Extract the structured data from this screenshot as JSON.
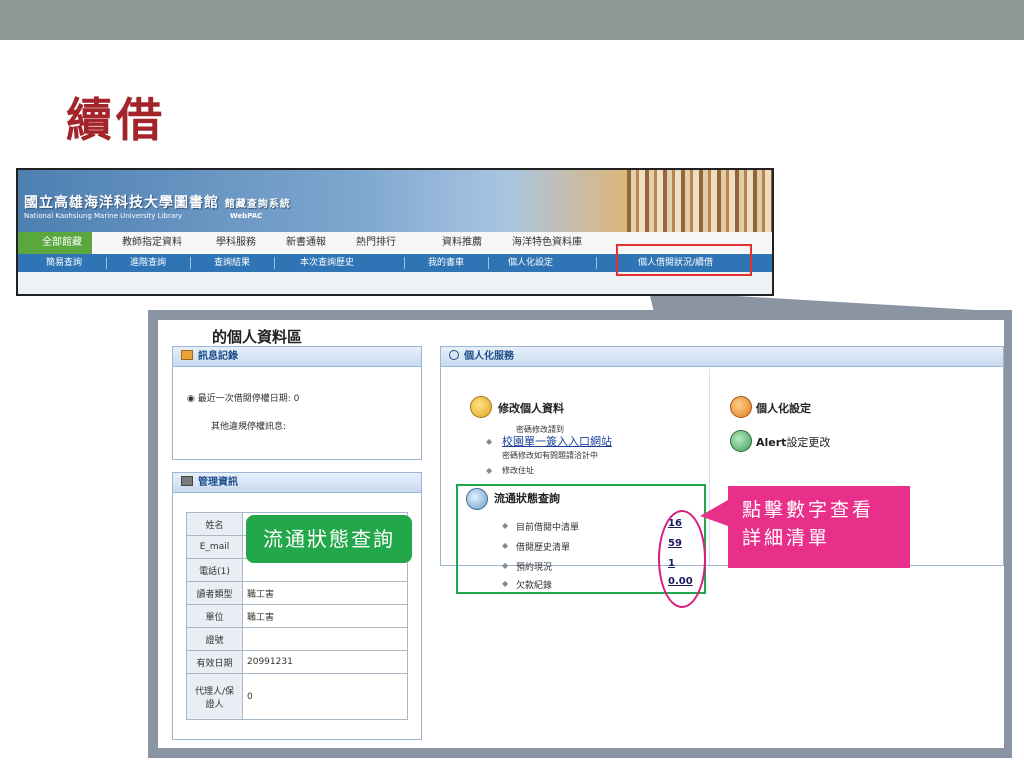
{
  "slide": {
    "title": "續借"
  },
  "library": {
    "name_zh": "國立高雄海洋科技大學圖書館",
    "system_zh": "館藏查詢系統",
    "name_en": "National Kaohsiung Marine University Library",
    "webpac": "WebPAC",
    "top_tabs": [
      "全部館藏",
      "教師指定資料",
      "學科服務",
      "新書通報",
      "熱門排行",
      "資料推薦",
      "海洋特色資料庫"
    ],
    "sub_nav": [
      "簡易查詢",
      "進階查詢",
      "查詢結果",
      "本次查詢歷史",
      "我的書車",
      "個人化設定",
      "個人借閱狀況/續借"
    ]
  },
  "panel": {
    "title": "的個人資料區",
    "messages": {
      "header": "訊息記錄",
      "last_suspend": "最近一次借閱停權日期: 0",
      "other": "其他違規停權訊息:"
    },
    "admin": {
      "header": "管理資訊",
      "rows": [
        {
          "label": "姓名",
          "value": ""
        },
        {
          "label": "E_mail",
          "value": ""
        },
        {
          "label": "電話(1)",
          "value": ""
        },
        {
          "label": "讀者類型",
          "value": "職工害"
        },
        {
          "label": "單位",
          "value": "職工害"
        },
        {
          "label": "證號",
          "value": ""
        },
        {
          "label": "有效日期",
          "value": "20991231"
        },
        {
          "label": "代理人/保證人",
          "value": "0"
        }
      ]
    },
    "services": {
      "header": "個人化服務",
      "modify_title": "修改個人資料",
      "pw_note1": "密碼修改請到",
      "portal_link": "校園單一簽入入口網站",
      "pw_note2": "密碼修改如有問題請洽計中",
      "address": "修改住址",
      "circ_title": "流通狀態查詢",
      "circ_items": [
        {
          "label": "目前借閱中清單",
          "value": "16"
        },
        {
          "label": "借閱歷史清單",
          "value": "59"
        },
        {
          "label": "預約現況",
          "value": "1"
        },
        {
          "label": "欠款紀錄",
          "value": "0.00"
        }
      ],
      "personal_settings": "個人化設定",
      "alert_prefix": "Alert",
      "alert_suffix": "設定更改"
    }
  },
  "callouts": {
    "green": "流通狀態查詢",
    "pink_line1": "點擊數字查看",
    "pink_line2": "詳細清單"
  },
  "colors": {
    "title_red": "#a3242b",
    "callout_green": "#22a84a",
    "callout_pink": "#e8308b",
    "highlight_red": "#e53030",
    "nav_blue": "#2f75b5"
  }
}
